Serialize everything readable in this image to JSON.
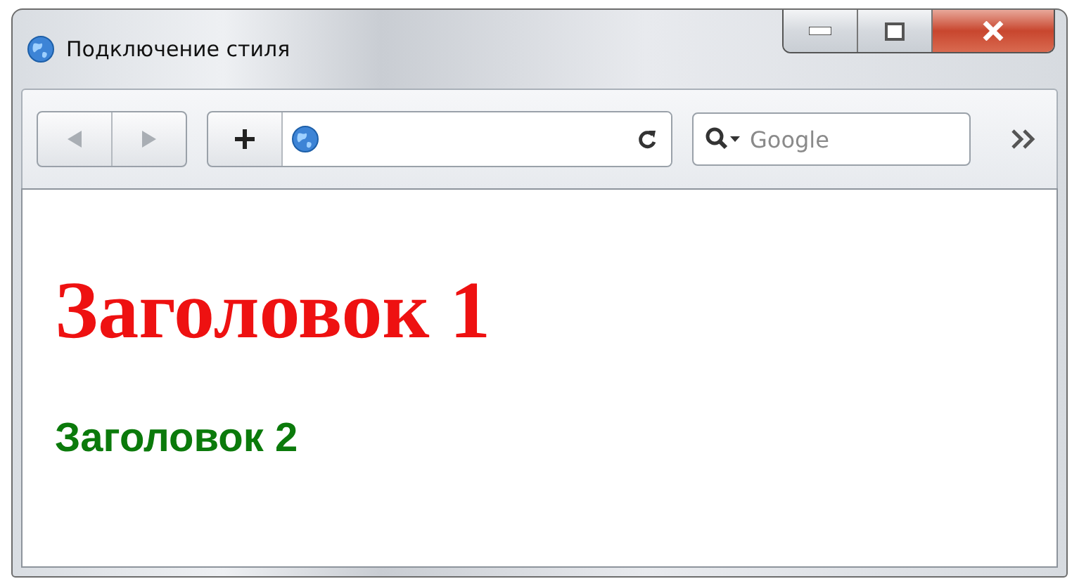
{
  "window": {
    "title": "Подключение стиля"
  },
  "search": {
    "placeholder": "Google"
  },
  "content": {
    "headings": [
      {
        "kind": "large",
        "text": "Заголовок 1"
      },
      {
        "kind": "small",
        "text": "Заголовок 2"
      }
    ]
  }
}
